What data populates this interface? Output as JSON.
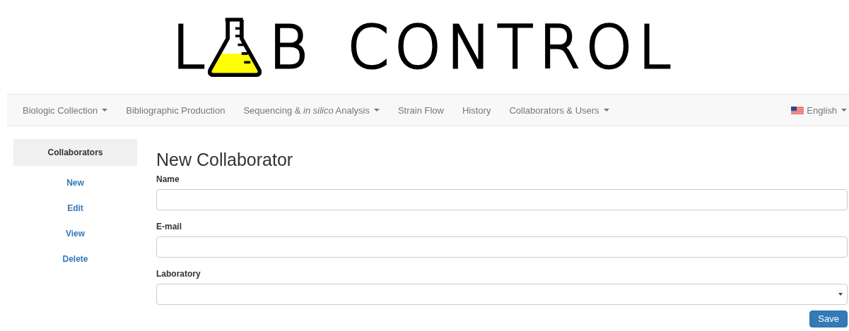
{
  "logo": {
    "before": "L",
    "after": "B",
    "word": "CONTROL"
  },
  "navbar": {
    "items": [
      {
        "label": "Biologic Collection",
        "dropdown": true
      },
      {
        "label": "Bibliographic Production",
        "dropdown": false
      },
      {
        "label": "Sequencing & *in silico* Analysis",
        "dropdown": true
      },
      {
        "label": "Strain Flow",
        "dropdown": false
      },
      {
        "label": "History",
        "dropdown": false
      },
      {
        "label": "Collaborators & Users",
        "dropdown": true
      }
    ],
    "language": {
      "label": "English",
      "dropdown": true
    }
  },
  "sidebar": {
    "title": "Collaborators",
    "items": [
      "New",
      "Edit",
      "View",
      "Delete"
    ]
  },
  "form": {
    "title": "New Collaborator",
    "fields": [
      {
        "label": "Name",
        "kind": "text"
      },
      {
        "label": "E-mail",
        "kind": "text"
      },
      {
        "label": "Laboratory",
        "kind": "select"
      }
    ],
    "submit": "Save"
  }
}
